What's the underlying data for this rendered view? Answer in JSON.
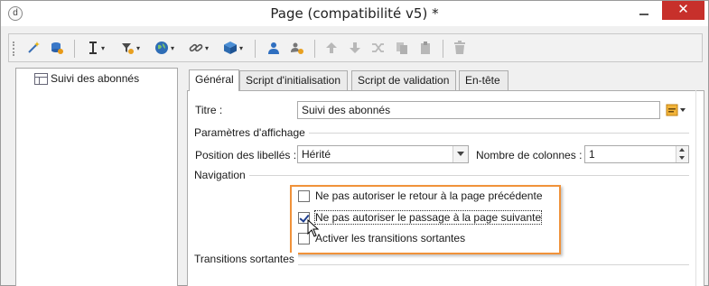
{
  "window": {
    "title": "Page (compatibilité v5) *",
    "close_glyph": "✕",
    "app_icon_glyph": "d"
  },
  "toolbar": {
    "buttons": [
      {
        "name": "wand-icon"
      },
      {
        "name": "database-refresh-icon"
      },
      {
        "name": "text-cursor-icon"
      },
      {
        "name": "filter-add-icon"
      },
      {
        "name": "globe-icon"
      },
      {
        "name": "link-icon"
      },
      {
        "name": "cube-icon"
      },
      {
        "name": "user-icon"
      },
      {
        "name": "user-settings-icon"
      },
      {
        "name": "arrow-up-icon"
      },
      {
        "name": "arrow-down-icon"
      },
      {
        "name": "shuffle-icon"
      },
      {
        "name": "copy-icon"
      },
      {
        "name": "paste-icon"
      },
      {
        "name": "delete-icon"
      }
    ],
    "caret": "▾"
  },
  "tree": {
    "items": [
      {
        "label": "Suivi des abonnés"
      }
    ]
  },
  "tabs": [
    {
      "label": "Général",
      "active": true
    },
    {
      "label": "Script d'initialisation",
      "active": false
    },
    {
      "label": "Script de validation",
      "active": false
    },
    {
      "label": "En-tête",
      "active": false
    }
  ],
  "form": {
    "title_label": "Titre :",
    "title_value": "Suivi des abonnés",
    "display_group": "Paramètres d'affichage",
    "label_position_label": "Position des libellés :",
    "label_position_value": "Hérité",
    "columns_label": "Nombre de colonnes :",
    "columns_value": "1",
    "navigation_group": "Navigation",
    "checkboxes": [
      {
        "label": "Ne pas autoriser le retour à la page précédente",
        "checked": false
      },
      {
        "label": "Ne pas autoriser le passage à la page suivante",
        "checked": true
      },
      {
        "label": "Activer les transitions sortantes",
        "checked": false
      }
    ],
    "transitions_group": "Transitions sortantes"
  },
  "colors": {
    "close_button": "#c7302b",
    "highlight_border": "#f0923a",
    "checkmark": "#1f3f8f"
  }
}
